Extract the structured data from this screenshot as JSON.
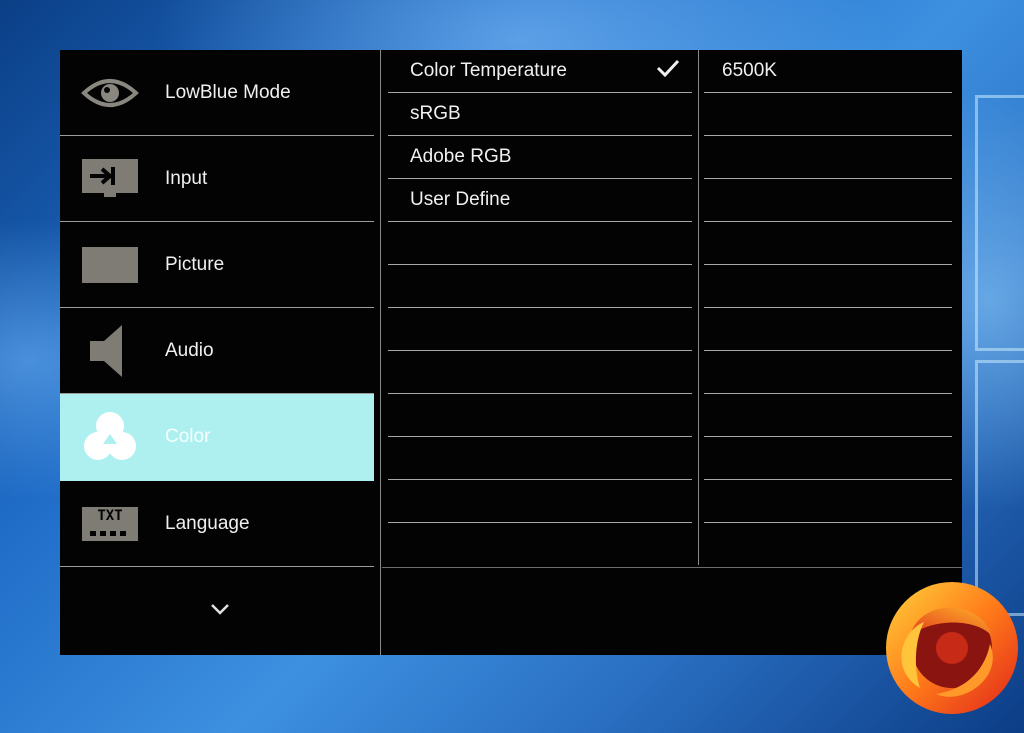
{
  "menu": {
    "items": [
      {
        "label": "LowBlue Mode",
        "icon": "eye-icon",
        "active": false
      },
      {
        "label": "Input",
        "icon": "input-icon",
        "active": false
      },
      {
        "label": "Picture",
        "icon": "picture-icon",
        "active": false
      },
      {
        "label": "Audio",
        "icon": "speaker-icon",
        "active": false
      },
      {
        "label": "Color",
        "icon": "color-circles-icon",
        "active": true
      },
      {
        "label": "Language",
        "icon": "txt-icon",
        "active": false
      }
    ],
    "more_icon": "chevron-down-icon"
  },
  "submenu": {
    "items": [
      {
        "label": "Color Temperature",
        "checked": true
      },
      {
        "label": "sRGB",
        "checked": false
      },
      {
        "label": "Adobe RGB",
        "checked": false
      },
      {
        "label": "User Define",
        "checked": false
      }
    ],
    "check_icon": "checkmark-icon"
  },
  "values": {
    "items": [
      {
        "label": "6500K"
      }
    ]
  },
  "txt_icon_text": "TXT",
  "colors": {
    "active_highlight": "#aef0f0",
    "osd_background": "#030303",
    "icon_gray": "#7f7b75"
  }
}
